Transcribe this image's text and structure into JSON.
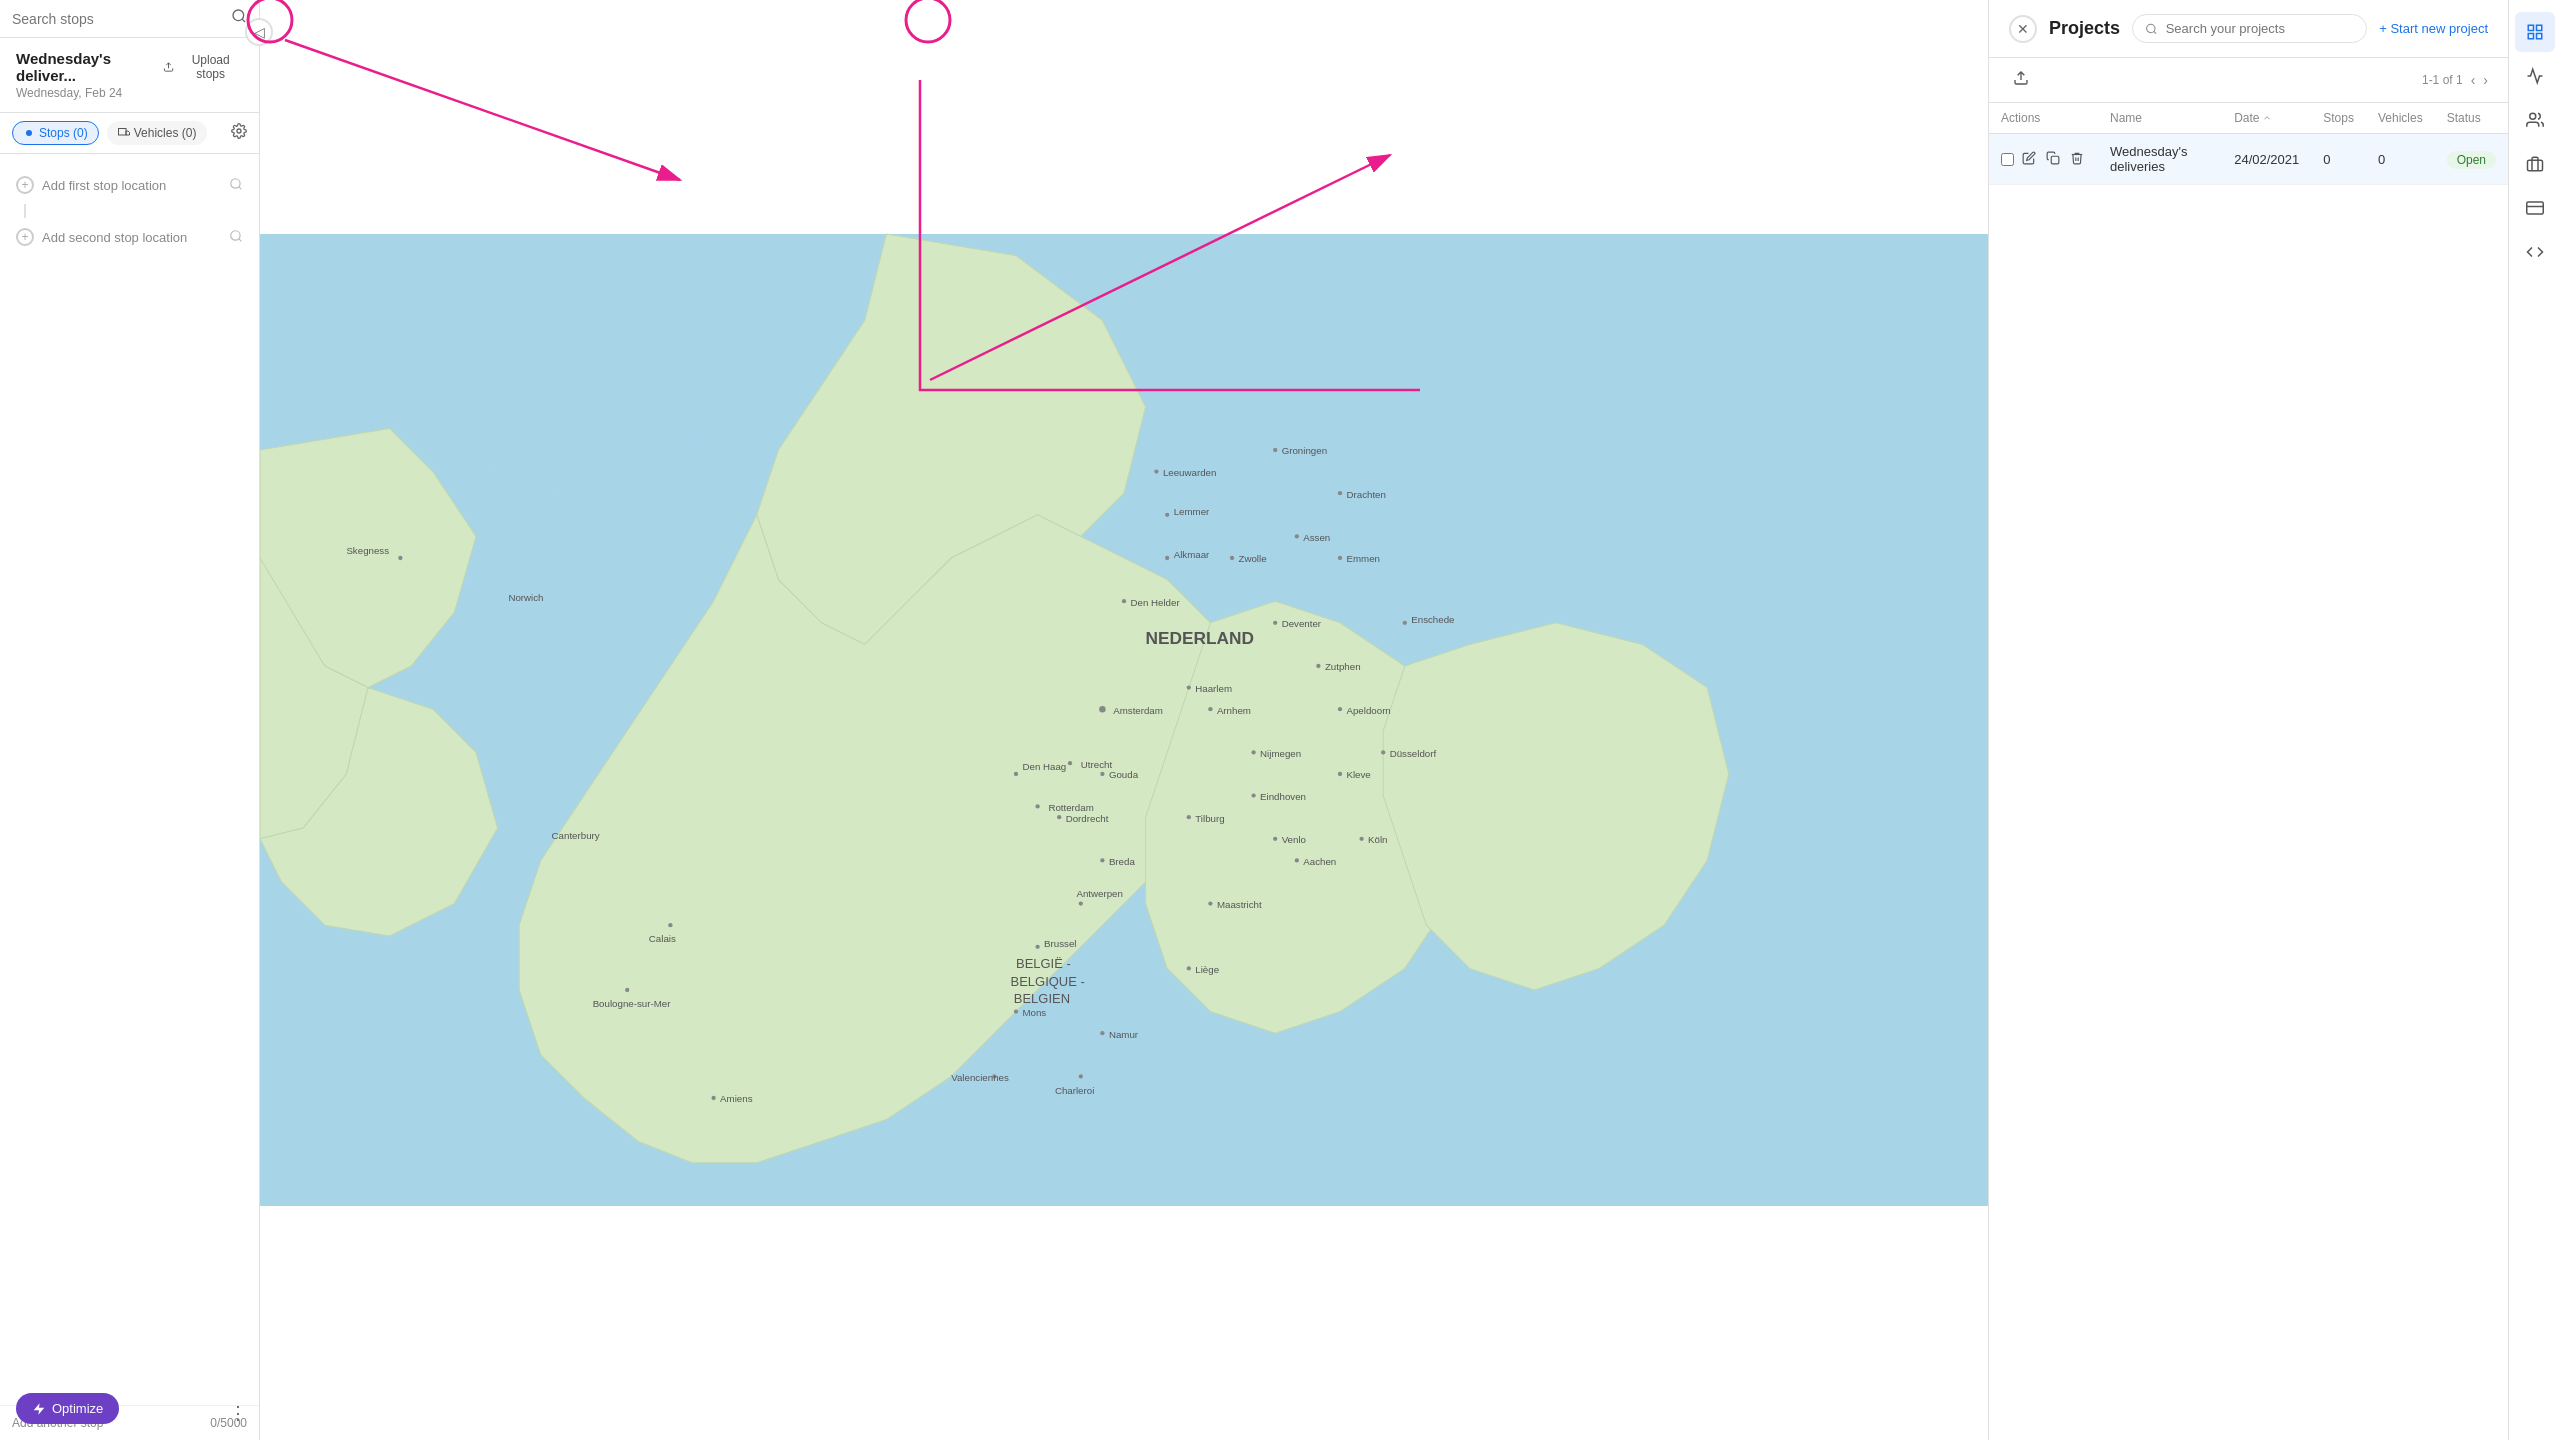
{
  "left_sidebar": {
    "search_placeholder": "Search stops",
    "collapse_icon": "◁",
    "project": {
      "title": "Wednesday's deliver...",
      "date": "Wednesday, Feb 24",
      "upload_label": "Upload stops"
    },
    "tabs": {
      "stops_label": "Stops (0)",
      "vehicles_label": "Vehicles (0)"
    },
    "stops": [
      {
        "label": "Add first stop location",
        "type": "first"
      },
      {
        "label": "Add second stop location",
        "type": "second"
      }
    ],
    "add_another_label": "Add another stop",
    "add_another_count": "0/5000",
    "optimize_label": "Optimize",
    "more_icon": "⋮"
  },
  "projects_panel": {
    "title": "Projects",
    "search_placeholder": "Search your projects",
    "start_new_label": "+ Start new project",
    "close_icon": "✕",
    "pagination": "1-1 of 1",
    "table": {
      "columns": [
        "Actions",
        "Name",
        "Date",
        "Stops",
        "Vehicles",
        "Status"
      ],
      "rows": [
        {
          "name": "Wednesday's deliveries",
          "date": "24/02/2021",
          "stops": "0",
          "vehicles": "0",
          "status": "Open",
          "selected": true
        }
      ]
    }
  },
  "right_bar": {
    "icons": [
      {
        "name": "layers-icon",
        "symbol": "⊞",
        "active": true
      },
      {
        "name": "chart-icon",
        "symbol": "📊",
        "active": false
      },
      {
        "name": "users-icon",
        "symbol": "👥",
        "active": false
      },
      {
        "name": "building-icon",
        "symbol": "🏢",
        "active": false
      },
      {
        "name": "card-icon",
        "symbol": "💳",
        "active": false
      },
      {
        "name": "code-icon",
        "symbol": "</>",
        "active": false
      }
    ]
  },
  "colors": {
    "accent_blue": "#1a73e8",
    "accent_purple": "#6c3fc5",
    "annotation_pink": "#e91e8c"
  }
}
